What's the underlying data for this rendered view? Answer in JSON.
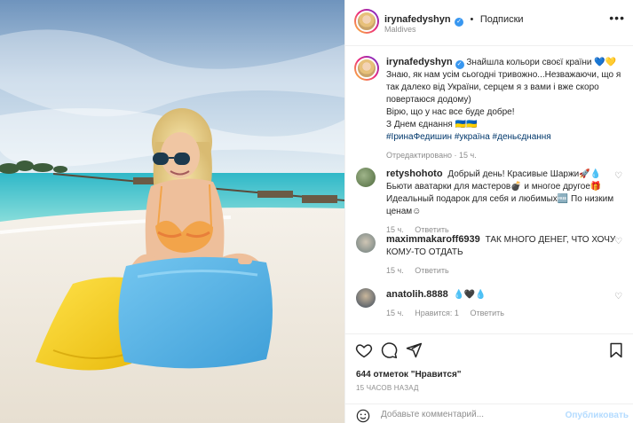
{
  "post": {
    "author": "irynafedyshyn",
    "follow_label": "Подписки",
    "location": "Maldives",
    "more_icon": "more-horizontal-icon"
  },
  "caption": {
    "username": "irynafedyshyn",
    "line1": "Знайшла кольори своєї країни 💙💛",
    "line2": "Знаю, як нам усім сьогодні тривожно...Незважаючи, що я так далеко від України, серцем я з вами і вже скоро повертаюся додому)",
    "line3": "Вірю, що у нас все буде добре!",
    "line4": "З Днем єднання 🇺🇦🇺🇦",
    "tags": "#ІринаФедишин #україна #деньєднання",
    "meta": "Отредактировано · 15 ч."
  },
  "comments": [
    {
      "username": "retyshohoto",
      "text": "Добрый день! Красивые Шаржи🚀💧 Бьюти аватарки для мастеров💣 и многое другое🎁 Идеальный подарок для себя и любимых🆓 По низким ценам☺",
      "time": "15 ч.",
      "reply": "Ответить"
    },
    {
      "username": "maximmakaroff6939",
      "text": "ТАК МНОГО ДЕНЕГ, ЧТО ХОЧУ КОМУ-ТО ОТДАТЬ",
      "time": "15 ч.",
      "reply": "Ответить"
    },
    {
      "username": "anatolih.8888",
      "text": "💧🖤💧",
      "time": "15 ч.",
      "likes": "Нравится: 1",
      "reply": "Ответить"
    }
  ],
  "actions": {
    "likes": "644 отметок \"Нравится\"",
    "ago": "15 ЧАСОВ НАЗАД",
    "comment_placeholder": "Добавьте комментарий...",
    "post_label": "Опубликовать"
  },
  "colors": {
    "accent": "#3897f0",
    "sky": "#8fb4d6",
    "sea": "#40c7c9",
    "sand": "#efe9df",
    "pillow_yellow": "#f5d21a",
    "pillow_blue": "#5db8ea"
  }
}
